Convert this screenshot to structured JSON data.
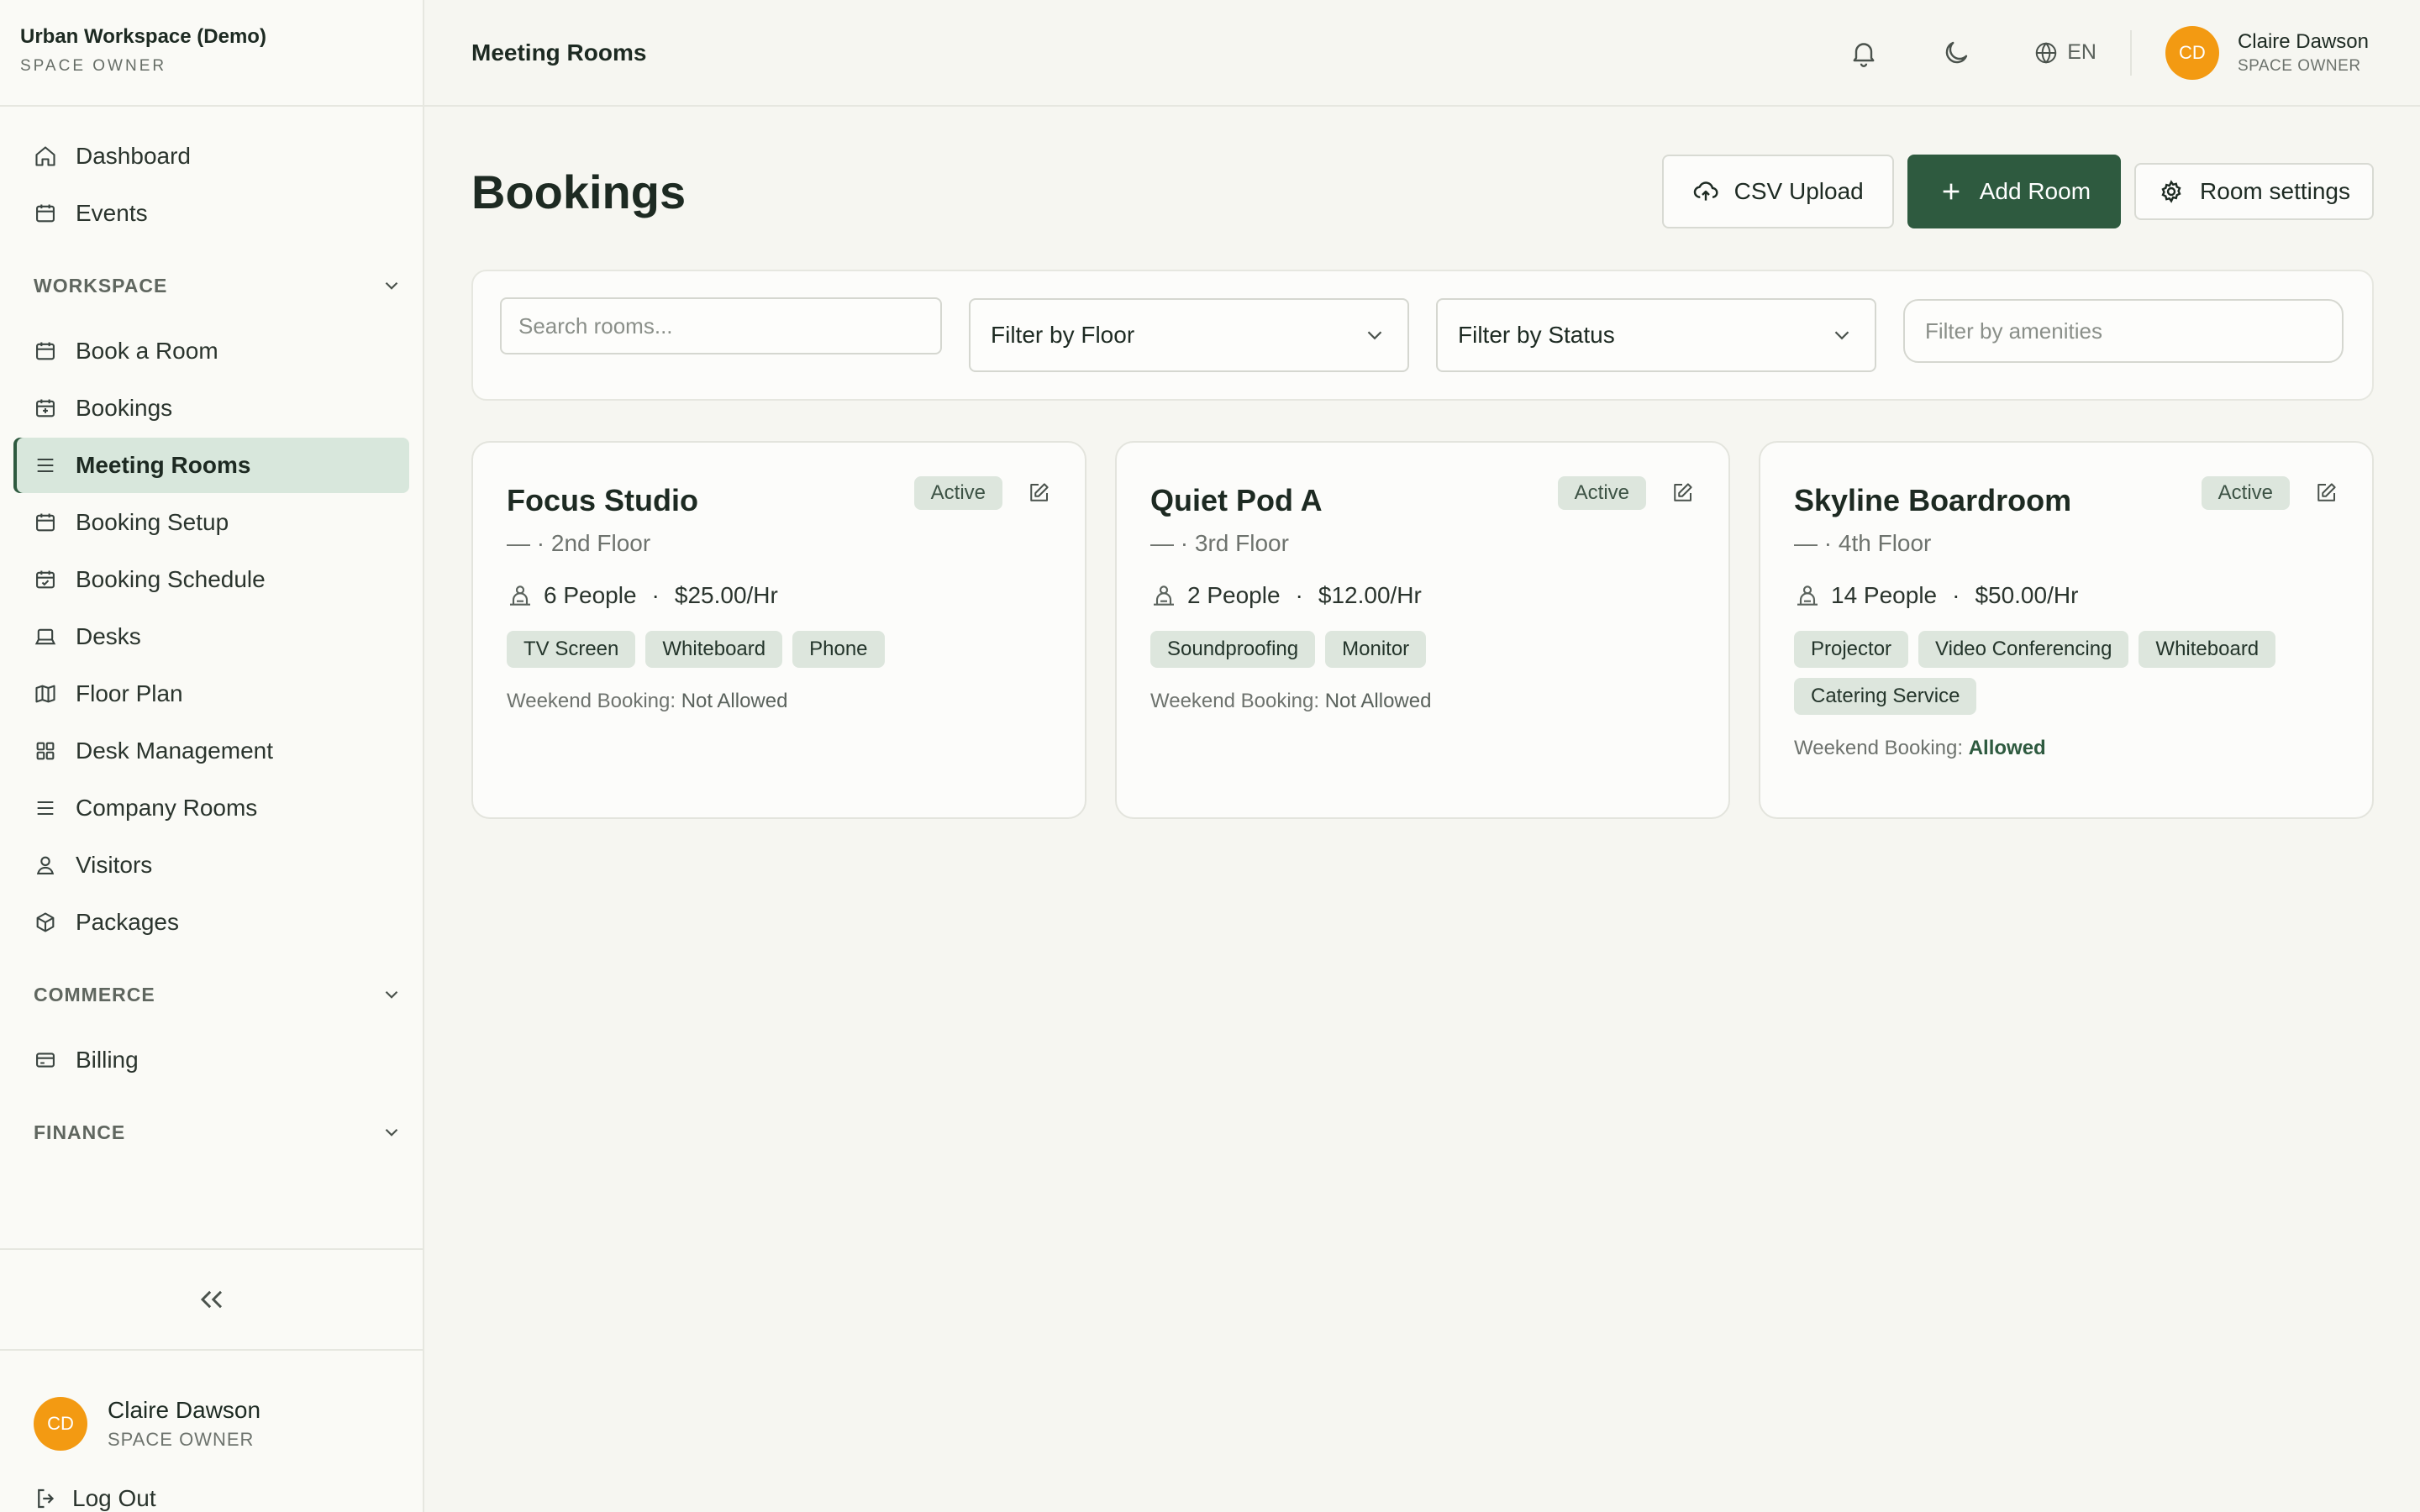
{
  "brand": {
    "name": "Urban Workspace (Demo)",
    "role": "SPACE OWNER"
  },
  "nav": {
    "top": [
      {
        "label": "Dashboard",
        "icon": "home-icon"
      },
      {
        "label": "Events",
        "icon": "calendar-icon"
      }
    ],
    "workspace_label": "WORKSPACE",
    "workspace": [
      {
        "label": "Book a Room",
        "icon": "calendar-icon"
      },
      {
        "label": "Bookings",
        "icon": "calendar-check-icon"
      },
      {
        "label": "Meeting Rooms",
        "icon": "list-icon",
        "active": true
      },
      {
        "label": "Booking Setup",
        "icon": "calendar-icon"
      },
      {
        "label": "Booking Schedule",
        "icon": "calendar-check-icon"
      },
      {
        "label": "Desks",
        "icon": "laptop-icon"
      },
      {
        "label": "Floor Plan",
        "icon": "map-icon"
      },
      {
        "label": "Desk Management",
        "icon": "grid-icon"
      },
      {
        "label": "Company Rooms",
        "icon": "list-icon"
      },
      {
        "label": "Visitors",
        "icon": "user-icon"
      },
      {
        "label": "Packages",
        "icon": "package-icon"
      }
    ],
    "commerce_label": "COMMERCE",
    "commerce": [
      {
        "label": "Billing",
        "icon": "credit-card-icon"
      }
    ],
    "finance_label": "FINANCE"
  },
  "user": {
    "initials": "CD",
    "name": "Claire Dawson",
    "role": "SPACE OWNER"
  },
  "logout_label": "Log Out",
  "topbar": {
    "title": "Meeting Rooms",
    "lang": "EN"
  },
  "page": {
    "title": "Bookings",
    "csv_label": "CSV Upload",
    "add_label": "Add Room",
    "settings_label": "Room settings"
  },
  "filters": {
    "search_placeholder": "Search rooms...",
    "floor_label": "Filter by Floor",
    "status_label": "Filter by Status",
    "amenities_placeholder": "Filter by amenities"
  },
  "rooms": [
    {
      "name": "Focus Studio",
      "status": "Active",
      "floor": "— · 2nd Floor",
      "people": "6 People",
      "price": "$25.00/Hr",
      "amenities": [
        "TV Screen",
        "Whiteboard",
        "Phone"
      ],
      "weekend_label": "Weekend Booking:",
      "weekend_value": "Not Allowed"
    },
    {
      "name": "Quiet Pod A",
      "status": "Active",
      "floor": "— · 3rd Floor",
      "people": "2 People",
      "price": "$12.00/Hr",
      "amenities": [
        "Soundproofing",
        "Monitor"
      ],
      "weekend_label": "Weekend Booking:",
      "weekend_value": "Not Allowed"
    },
    {
      "name": "Skyline Boardroom",
      "status": "Active",
      "floor": "— · 4th Floor",
      "people": "14 People",
      "price": "$50.00/Hr",
      "amenities": [
        "Projector",
        "Video Conferencing",
        "Whiteboard",
        "Catering Service"
      ],
      "weekend_label": "Weekend Booking:",
      "weekend_value": "Allowed"
    }
  ],
  "colors": {
    "accent": "#2e5a3f",
    "avatar": "#f39a12",
    "active_nav": "#d8e7dc",
    "tag": "#dde6dd"
  }
}
